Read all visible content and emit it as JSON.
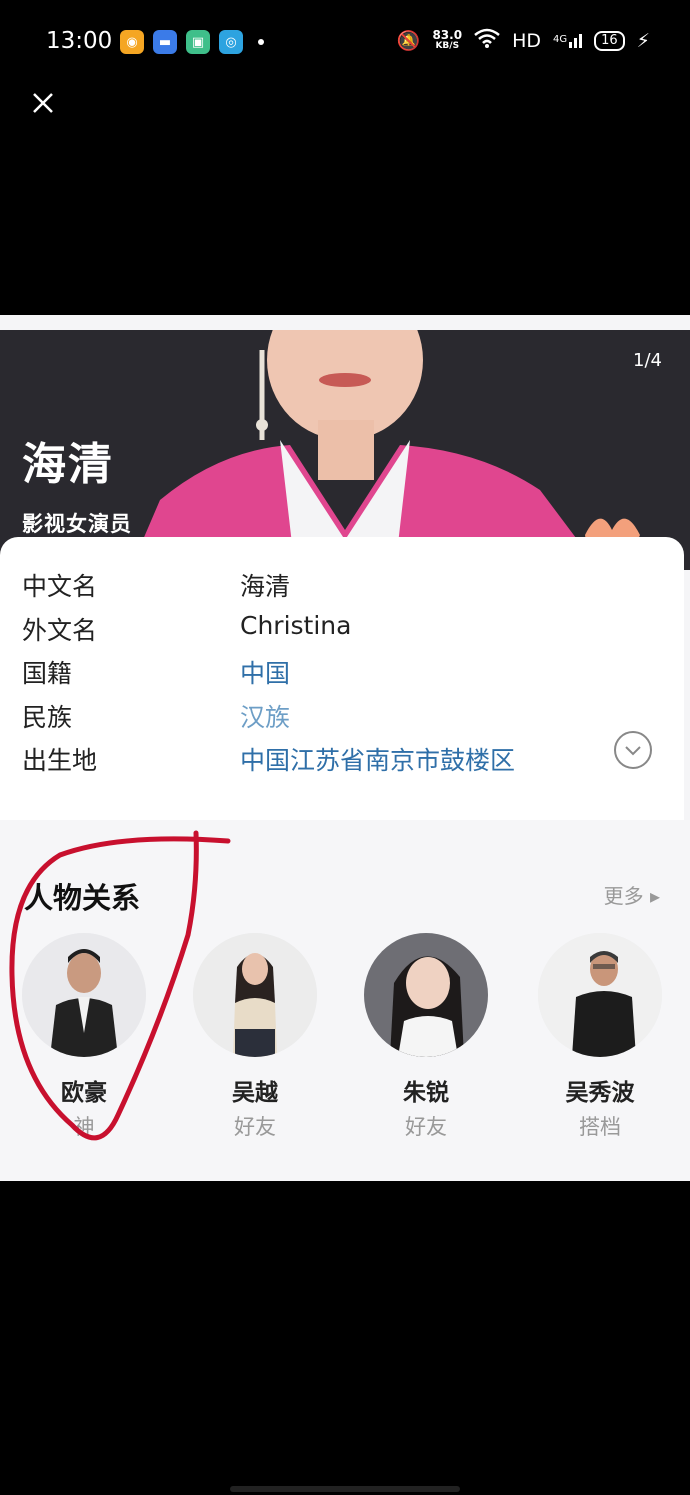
{
  "status_bar": {
    "time": "13:00",
    "net_speed": "83.0",
    "net_speed_unit": "KB/S",
    "network": "HD",
    "signal": "4G",
    "battery": "16"
  },
  "overlay": {
    "close_icon": "close-icon"
  },
  "banner": {
    "counter": "1/4",
    "name": "海清",
    "subtitle": "影视女演员"
  },
  "info": {
    "rows": [
      {
        "label": "中文名",
        "value": "海清"
      },
      {
        "label": "外文名",
        "value": "Christina"
      },
      {
        "label": "国籍",
        "value": "中国"
      },
      {
        "label": "民族",
        "value": "汉族"
      },
      {
        "label": "出生地",
        "value": "中国江苏省南京市鼓楼区"
      }
    ]
  },
  "relations": {
    "title": "人物关系",
    "more": "更多 ▸",
    "people": [
      {
        "name": "欧豪",
        "role": "神"
      },
      {
        "name": "吴越",
        "role": "好友"
      },
      {
        "name": "朱锐",
        "role": "好友"
      },
      {
        "name": "吴秀波",
        "role": "搭档"
      }
    ]
  },
  "colors": {
    "accent_link": "#2f6fa8",
    "annotation": "#c8102e",
    "blazer": "#e0468f"
  }
}
